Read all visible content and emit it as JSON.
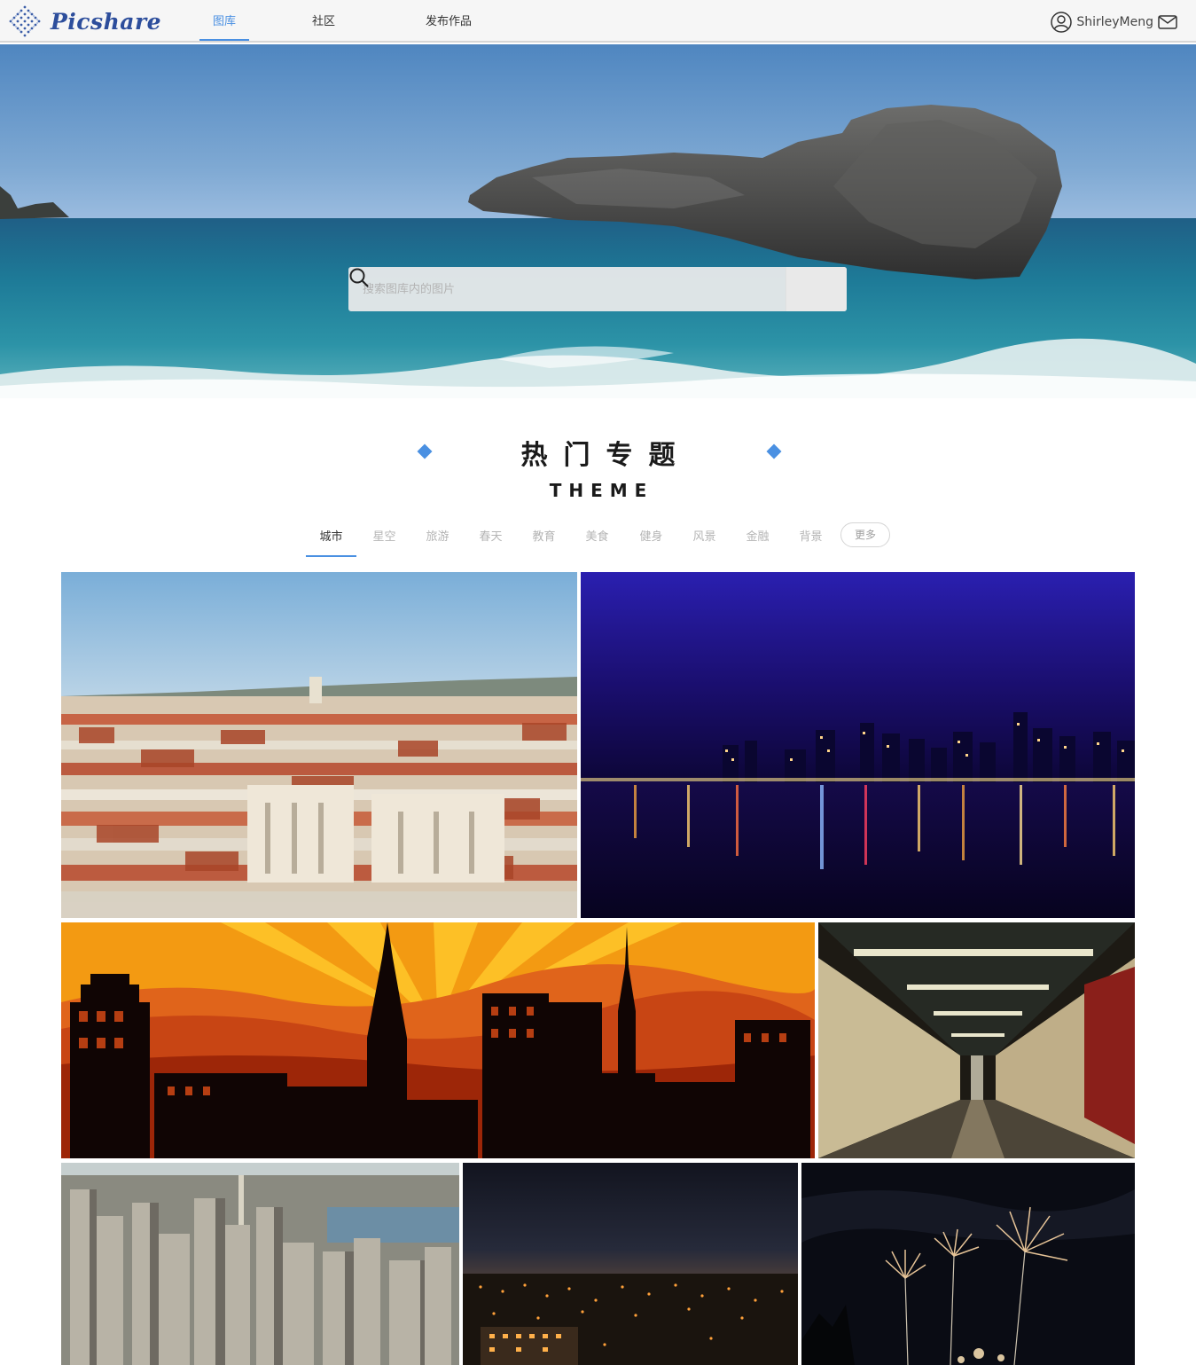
{
  "header": {
    "logo_text": "Picshare",
    "nav": [
      {
        "label": "图库",
        "active": true
      },
      {
        "label": "社区",
        "active": false
      },
      {
        "label": "发布作品",
        "active": false
      }
    ],
    "username": "ShirleyMeng",
    "icons": {
      "user": "user-circle-icon",
      "mail": "mail-icon"
    }
  },
  "hero": {
    "search_placeholder": "搜索图库内的图片",
    "search_icon": "search-icon"
  },
  "section": {
    "title": "热门专题",
    "subtitle": "THEME"
  },
  "topics": {
    "tabs": [
      "城市",
      "星空",
      "旅游",
      "春天",
      "教育",
      "美食",
      "健身",
      "风景",
      "金融",
      "背景"
    ],
    "active_tab": "城市",
    "more_label": "更多"
  },
  "colors": {
    "accent": "#4a90e2",
    "logo": "#2d4e9c"
  }
}
